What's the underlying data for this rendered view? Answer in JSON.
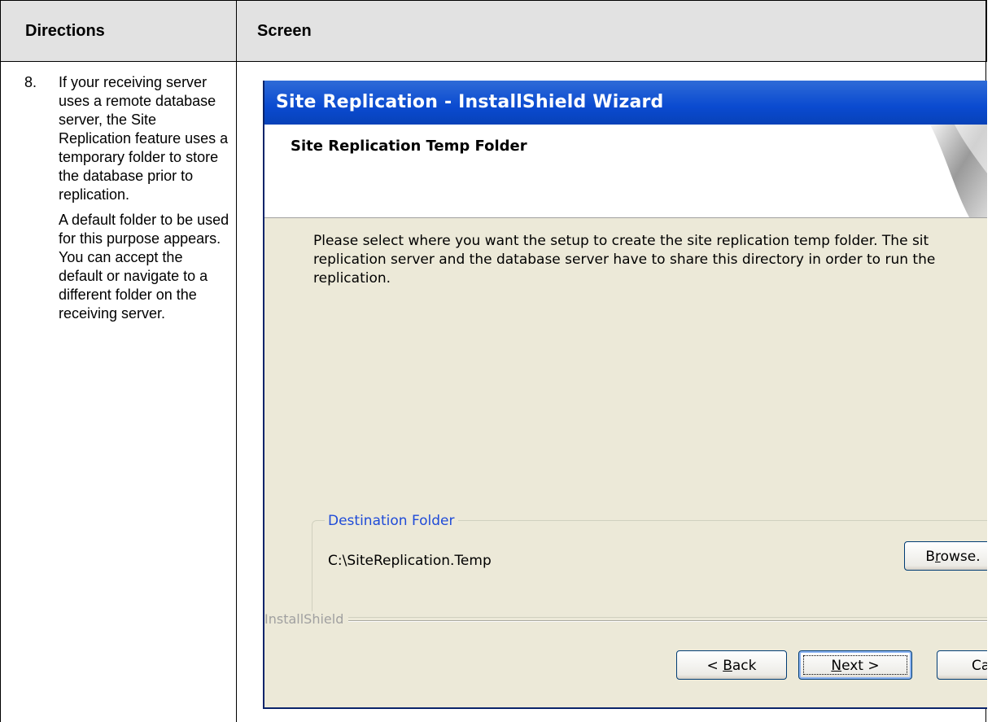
{
  "table": {
    "header_directions": "Directions",
    "header_screen": "Screen"
  },
  "step": {
    "number": "8.",
    "paragraph1": "If your receiving server uses a remote database server, the Site Replication feature uses a temporary folder to store the database prior to replication.",
    "paragraph2": "A default folder to be used for this purpose appears. You can accept the default or navigate to a different folder on the receiving server."
  },
  "wizard": {
    "title": "Site Replication - InstallShield Wizard",
    "banner_title": "Site Replication Temp Folder",
    "description_line1": "Please select where you want the setup to create the site replication temp folder. The sit",
    "description_line2": "replication server and the database server have to share this directory in order to run the",
    "description_line3": "replication.",
    "group_label": "Destination Folder",
    "destination_path": "C:\\SiteReplication.Temp",
    "browse_prefix": "B",
    "browse_underlined": "r",
    "browse_suffix": "owse.",
    "installshield_label": "InstallShield",
    "back_prefix": "< ",
    "back_underlined": "B",
    "back_suffix": "ack",
    "next_underlined": "N",
    "next_suffix": "ext >",
    "cancel_label": "Ca"
  }
}
